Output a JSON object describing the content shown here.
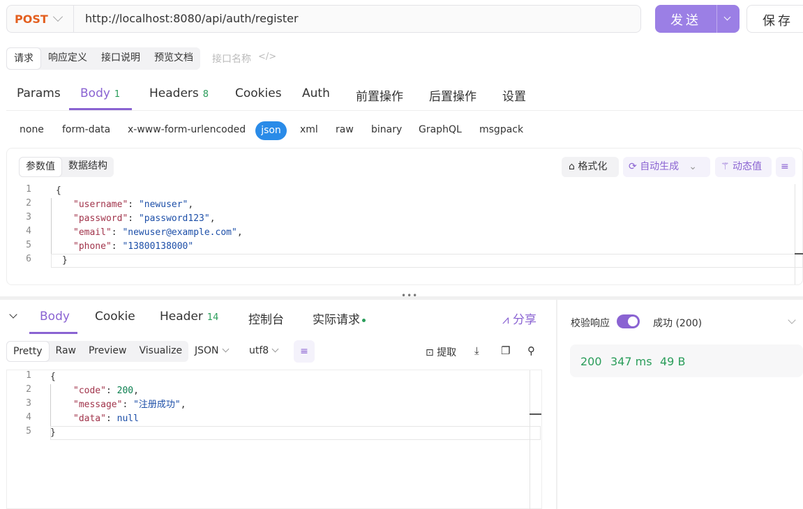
{
  "request": {
    "method": "POST",
    "url": "http://localhost:8080/api/auth/register",
    "send_label": "发送",
    "save_label": "保存"
  },
  "subtabs": [
    "请求",
    "响应定义",
    "接口说明",
    "预览文档"
  ],
  "api_name_placeholder": "接口名称",
  "main_tabs": {
    "params": "Params",
    "body": "Body",
    "body_count": "1",
    "headers": "Headers",
    "headers_count": "8",
    "cookies": "Cookies",
    "auth": "Auth",
    "pre": "前置操作",
    "post": "后置操作",
    "settings": "设置"
  },
  "body_types": [
    "none",
    "form-data",
    "x-www-form-urlencoded",
    "json",
    "xml",
    "raw",
    "binary",
    "GraphQL",
    "msgpack"
  ],
  "editor": {
    "tabs": [
      "参数值",
      "数据结构"
    ],
    "format_label": "格式化",
    "auto_label": "自动生成",
    "dynamic_label": "动态值",
    "line_numbers": [
      "1",
      "2",
      "3",
      "4",
      "5",
      "6"
    ],
    "fields": [
      {
        "key": "\"username\"",
        "value": "\"newuser\"",
        "sep": ","
      },
      {
        "key": "\"password\"",
        "value": "\"password123\"",
        "sep": ","
      },
      {
        "key": "\"email\"",
        "value": "\"newuser@example.com\"",
        "sep": ","
      },
      {
        "key": "\"phone\"",
        "value": "\"13800138000\"",
        "sep": ""
      }
    ],
    "open_brace": "{",
    "close_brace": "}"
  },
  "response_tabs": {
    "body": "Body",
    "cookie": "Cookie",
    "header": "Header",
    "header_count": "14",
    "console": "控制台",
    "actual": "实际请求",
    "share": "分享"
  },
  "view_tabs": [
    "Pretty",
    "Raw",
    "Preview",
    "Visualize"
  ],
  "format_select": "JSON",
  "encoding_select": "utf8",
  "extract_label": "提取",
  "response": {
    "line_numbers": [
      "1",
      "2",
      "3",
      "4",
      "5"
    ],
    "open_brace": "{",
    "close_brace": "}",
    "code_key": "\"code\"",
    "code_val": "200",
    "message_key": "\"message\"",
    "message_val": "\"注册成功\"",
    "data_key": "\"data\"",
    "data_val": "null"
  },
  "right_panel": {
    "verify_label": "校验响应",
    "status": "成功 (200)",
    "code": "200",
    "time": "347 ms",
    "size": "49 B"
  },
  "colors": {
    "accent": "#8a63d2",
    "method": "#e35f1f",
    "success": "#2a9d5a",
    "json_pill": "#2a8be8"
  }
}
